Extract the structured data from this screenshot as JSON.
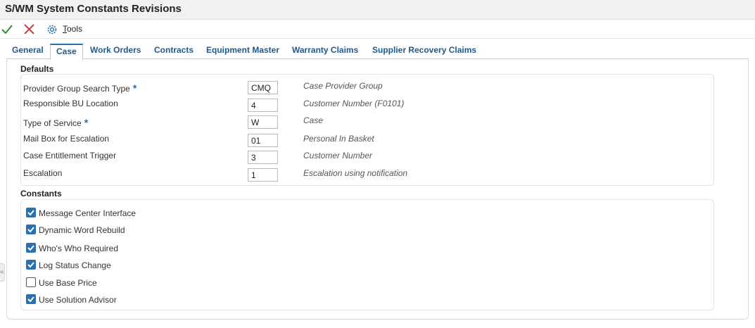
{
  "window": {
    "title": "S/WM System Constants Revisions"
  },
  "toolbar": {
    "ok_icon": "check-icon",
    "cancel_icon": "close-icon",
    "tools_icon": "gear-icon",
    "tools_label_first": "T",
    "tools_label_rest": "ools"
  },
  "tabs": [
    {
      "label": "General",
      "active": false
    },
    {
      "label": "Case",
      "active": true
    },
    {
      "label": "Work Orders",
      "active": false
    },
    {
      "label": "Contracts",
      "active": false
    },
    {
      "label": "Equipment Master",
      "active": false
    },
    {
      "label": "Warranty Claims",
      "active": false
    },
    {
      "label": "Supplier Recovery Claims",
      "active": false
    }
  ],
  "defaults": {
    "heading": "Defaults",
    "fields": [
      {
        "label": "Provider Group Search Type",
        "required": true,
        "value": "CMQ",
        "description": "Case Provider Group"
      },
      {
        "label": "Responsible BU Location",
        "required": false,
        "value": "4",
        "description": "Customer Number (F0101)"
      },
      {
        "label": "Type of Service",
        "required": true,
        "value": "W",
        "description": "Case"
      },
      {
        "label": "Mail Box for Escalation",
        "required": false,
        "value": "01",
        "description": "Personal In Basket"
      },
      {
        "label": "Case Entitlement Trigger",
        "required": false,
        "value": "3",
        "description": "Customer Number"
      },
      {
        "label": "Escalation",
        "required": false,
        "value": "1",
        "description": "Escalation using notification"
      }
    ],
    "required_marker": "*"
  },
  "constants": {
    "heading": "Constants",
    "options": [
      {
        "label": "Message Center Interface",
        "checked": true
      },
      {
        "label": "Dynamic Word Rebuild",
        "checked": true
      },
      {
        "label": "Who's Who Required",
        "checked": true
      },
      {
        "label": "Log Status Change",
        "checked": true
      },
      {
        "label": "Use Base Price",
        "checked": false
      },
      {
        "label": "Use Solution Advisor",
        "checked": true
      }
    ]
  },
  "collapse_handle": {
    "glyph": "«"
  },
  "colors": {
    "accent": "#2a6fae",
    "ok": "#3a8a3a",
    "cancel": "#d33b3b",
    "tab_text": "#1f5a8b"
  }
}
